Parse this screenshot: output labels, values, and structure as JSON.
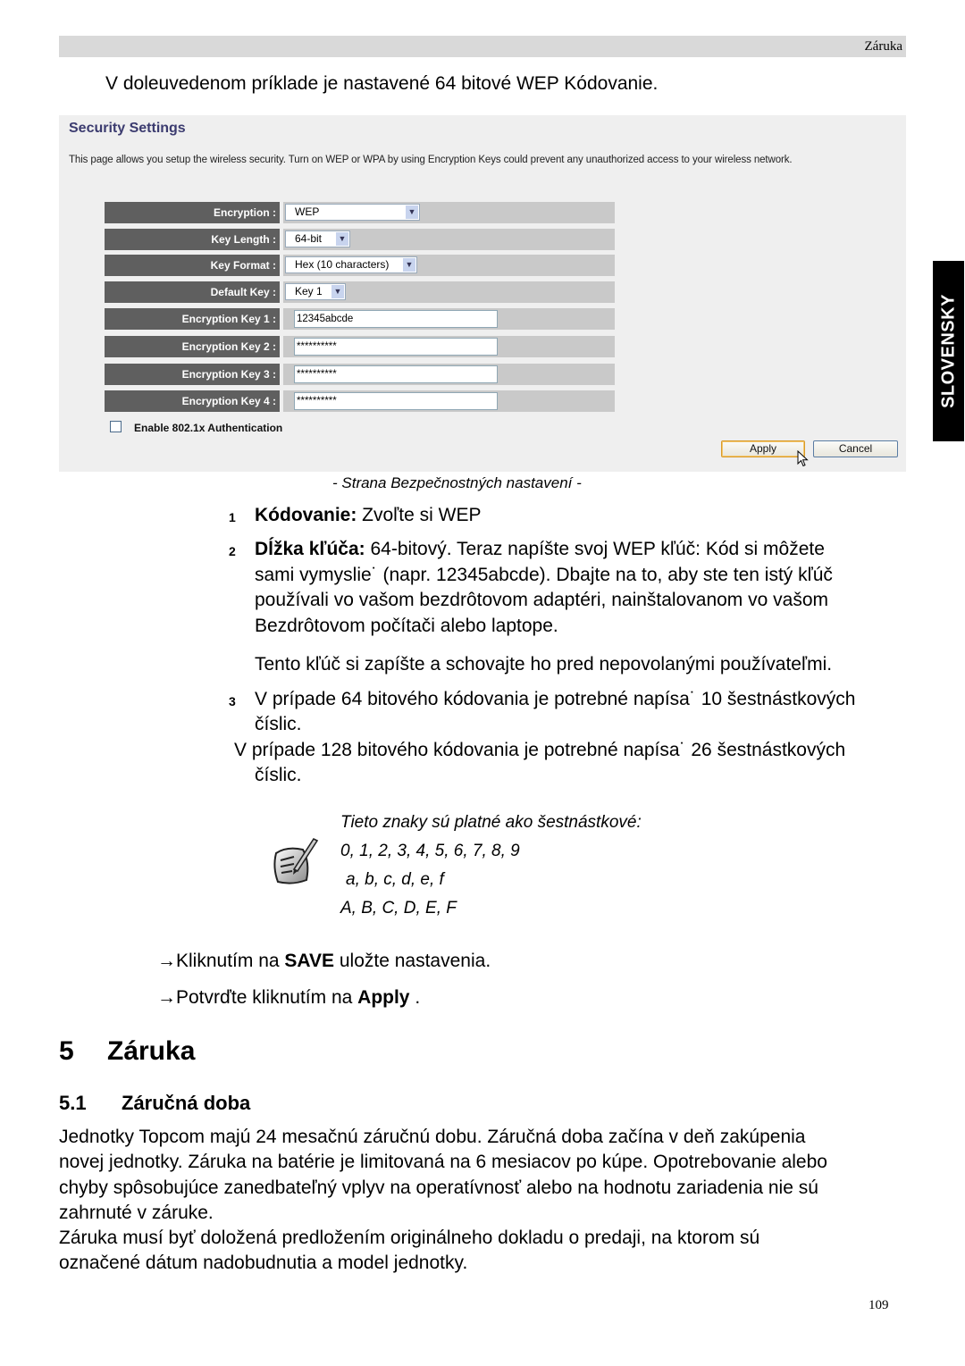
{
  "header": {
    "section_title": "Záruka"
  },
  "intro": "V doleuvedenom príklade je nastavené 64 bitové WEP Kódovanie.",
  "security_panel": {
    "title": "Security Settings",
    "description": "This page allows you setup the wireless security. Turn on WEP or WPA by using Encryption Keys could prevent any unauthorized access to your wireless network.",
    "fields": {
      "encryption": {
        "label": "Encryption :",
        "value": "WEP"
      },
      "key_length": {
        "label": "Key Length :",
        "value": "64-bit"
      },
      "key_format": {
        "label": "Key Format :",
        "value": "Hex (10 characters)"
      },
      "default_key": {
        "label": "Default Key :",
        "value": "Key 1"
      },
      "key1": {
        "label": "Encryption Key 1 :",
        "value": "12345abcde"
      },
      "key2": {
        "label": "Encryption Key 2 :",
        "value": "**********"
      },
      "key3": {
        "label": "Encryption Key 3 :",
        "value": "**********"
      },
      "key4": {
        "label": "Encryption Key 4 :",
        "value": "**********"
      }
    },
    "auth_checkbox": {
      "label": "Enable 802.1x Authentication",
      "checked": false
    },
    "apply_label": "Apply",
    "cancel_label": "Cancel"
  },
  "side_tab": "SLOVENSKY",
  "caption": "- Strana Bezpečnostných nastavení -",
  "steps": [
    {
      "num": "1",
      "bold": "Kódovanie:",
      "text": " Zvoľte si WEP"
    },
    {
      "num": "2",
      "bold": "Dĺžka kľúča:",
      "text": " 64-bitový. Teraz napíšte svoj WEP kľúč: Kód si môžete",
      "lines": [
        "sami vymyslie˙ (napr. 12345abcde). Dbajte na to, aby ste ten istý kľúč",
        "používali vo vašom bezdrôtovom adaptéri, nainštalovanom vo vašom",
        "Bezdrôtovom počítači alebo laptope."
      ],
      "extra": "Tento kľúč si zapíšte a schovajte ho pred nepovolanými používateľmi."
    },
    {
      "num": "3",
      "text": "V prípade 64 bitového kódovania je potrebné napísa˙ 10 šestnástkových",
      "line2": "číslic.",
      "line3": "V prípade 128 bitového kódovania je potrebné napísa˙ 26 šestnástkových",
      "line4": "číslic."
    }
  ],
  "note": {
    "icon": "note-pen-icon",
    "title": "Tieto znaky sú platné ako šestnástkové:",
    "digits": "0, 1, 2, 3, 4, 5, 6, 7, 8, 9",
    "lower": "a, b, c, d, e, f",
    "upper": "A, B, C, D, E, F"
  },
  "actions": [
    {
      "arrow": "→",
      "pre": "Kliknutím na ",
      "bold": "SAVE",
      "post": " uložte nastavenia."
    },
    {
      "arrow": "→",
      "pre": "Potvrďte kliknutím na ",
      "bold": "Apply",
      "post": " ."
    }
  ],
  "section": {
    "num": "5",
    "title": "Záruka"
  },
  "subsection": {
    "num": "5.1",
    "title": "Záručná doba"
  },
  "body_lines": [
    "Jednotky Topcom majú 24 mesačnú záručnú dobu. Záručná doba začína v deň zakúpenia",
    "novej jednotky. Záruka na batérie je limitovaná na 6 mesiacov po kúpe. Opotrebovanie alebo",
    "chyby spôsobujúce zanedbateľný vplyv na operatívnosť alebo na hodnotu zariadenia nie sú",
    "zahrnuté v záruke.",
    "Záruka musí byť doložená predložením originálneho dokladu o predaji, na ktorom sú",
    "označené dátum nadobudnutia a model jednotky."
  ],
  "page_number": "109"
}
